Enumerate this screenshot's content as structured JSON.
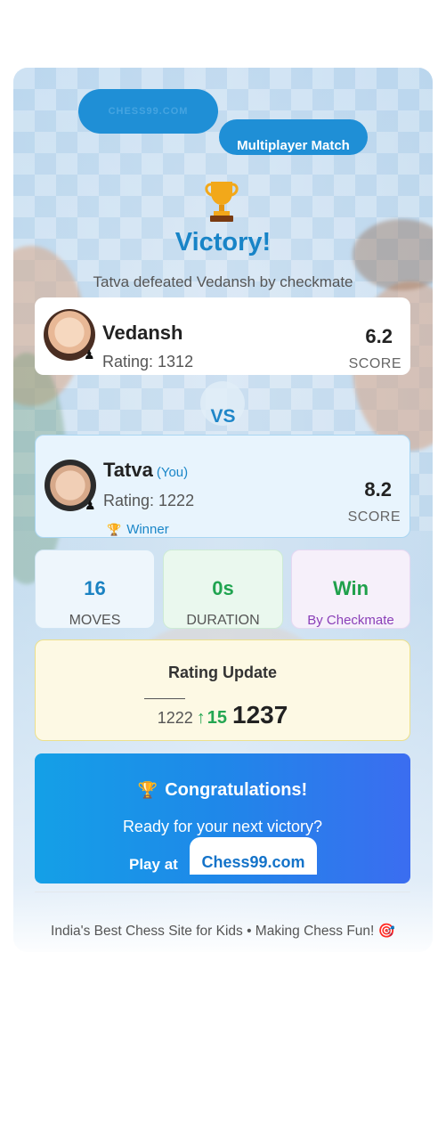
{
  "header": {
    "logo_text": "CHESS99.COM",
    "match_type": "Multiplayer Match"
  },
  "result": {
    "title": "Victory!",
    "subtitle": "Tatva defeated Vedansh by checkmate",
    "trophy_icon": "trophy-icon"
  },
  "players": {
    "opponent": {
      "name": "Vedansh",
      "rating": "Rating: 1312",
      "score": "6.2",
      "score_label": "SCORE"
    },
    "vs_label": "VS",
    "you": {
      "name": "Tatva",
      "you_tag": "(You)",
      "rating": "Rating: 1222",
      "score": "8.2",
      "score_label": "SCORE",
      "winner_label": "Winner"
    }
  },
  "stats": [
    {
      "value": "16",
      "label": "MOVES"
    },
    {
      "value": "0s",
      "label": "DURATION"
    },
    {
      "value": "Win",
      "label": "By Checkmate"
    }
  ],
  "rating_update": {
    "title": "Rating Update",
    "old": "1222",
    "arrow": "↑",
    "delta": "15",
    "new": "1237"
  },
  "congrats": {
    "title": "Congratulations!",
    "subtitle": "Ready for your next victory?",
    "play_at": "Play at",
    "site": "Chess99.com"
  },
  "footer": {
    "text": "India's Best Chess Site for Kids • Making Chess Fun!",
    "icon": "🎯"
  },
  "colors": {
    "primary_blue": "#1f8fd6",
    "victory_blue": "#1884c7",
    "green": "#24a651",
    "purple": "#8a3fb8",
    "rating_bg": "#fdf9e4",
    "banner_gradient_start": "#14a0e7",
    "banner_gradient_end": "#3b6df0"
  }
}
